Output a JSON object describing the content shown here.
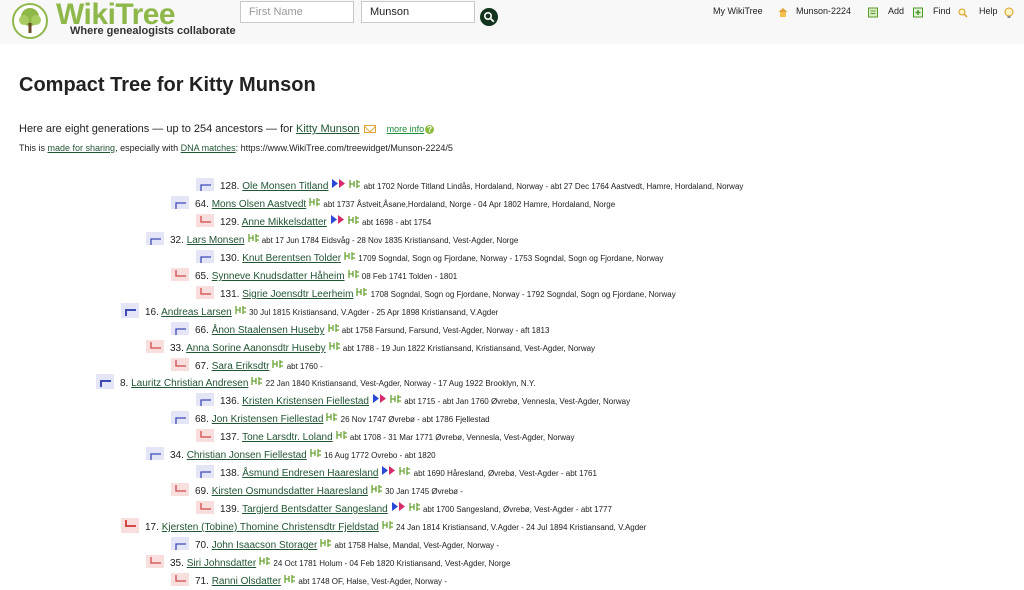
{
  "header": {
    "logo_text": "WikiTree",
    "tagline": "Where genealogists collaborate",
    "first_name_placeholder": "First Name",
    "last_name_value": "Munson",
    "nav": {
      "my_wikitree": "My WikiTree",
      "profile_id": "Munson-2224",
      "add": "Add",
      "find": "Find",
      "help": "Help"
    }
  },
  "page": {
    "title": "Compact Tree for Kitty Munson",
    "intro_prefix": "Here are eight generations — up to 254 ancestors — for",
    "intro_person": "Kitty Munson",
    "more_info": "more info",
    "sub_this": "This is",
    "sub_made_for_sharing": "made for sharing",
    "sub_middle": ", especially with",
    "sub_dna": "DNA matches",
    "sub_url": ": https://www.WikiTree.com/treewidget/Munson-2224/5"
  },
  "colors": {
    "brand_green": "#8fb84a",
    "link_green": "#225533",
    "father_box": "#e4e6f8",
    "mother_box": "#f9dede",
    "father_line": "#3c4bb8",
    "mother_line": "#d24a4a"
  },
  "tree": [
    {
      "num": "128.",
      "name": "Ole Monsen Titland",
      "dna": true,
      "details": "abt 1702 Norde Titland Lindås, Hordaland, Norway - abt 27 Dec 1764 Aastvedt, Hamre, Hordaland, Norway"
    },
    {
      "num": "64.",
      "name": "Mons Olsen Aastvedt",
      "dna": false,
      "details": "abt 1737 Åstveit,Åsane,Hordaland, Norge - 04 Apr 1802 Hamre, Hordaland, Norge"
    },
    {
      "num": "129.",
      "name": "Anne Mikkelsdatter",
      "dna": true,
      "details": "abt 1698 - abt 1754"
    },
    {
      "num": "32.",
      "name": "Lars Monsen",
      "dna": false,
      "details": "abt 17 Jun 1784 Eidsvåg - 28 Nov 1835 Kristiansand, Vest-Agder, Norge"
    },
    {
      "num": "130.",
      "name": "Knut Berentsen Tolder",
      "dna": false,
      "details": "1709 Sogndal, Sogn og Fjordane, Norway - 1753 Sogndal, Sogn og Fjordane, Norway"
    },
    {
      "num": "65.",
      "name": "Synneve Knudsdatter Håheim",
      "dna": false,
      "details": "08 Feb 1741 Tolden - 1801"
    },
    {
      "num": "131.",
      "name": "Sigrie Joensdtr Leerheim",
      "dna": false,
      "details": "1708 Sogndal, Sogn og Fjordane, Norway - 1792 Sogndal, Sogn og Fjordane, Norway"
    },
    {
      "num": "16.",
      "name": "Andreas Larsen",
      "dna": false,
      "details": "30 Jul 1815 Kristiansand, V.Agder - 25 Apr 1898 Kristiansand, V.Agder"
    },
    {
      "num": "66.",
      "name": "Ånon Staalensen Huseby",
      "dna": false,
      "details": "abt 1758 Farsund, Farsund, Vest-Agder, Norway - aft 1813"
    },
    {
      "num": "33.",
      "name": "Anna Sorine Aanonsdtr Huseby",
      "dna": false,
      "details": "abt 1788 - 19 Jun 1822 Kristiansand, Kristiansand, Vest-Agder, Norway"
    },
    {
      "num": "67.",
      "name": "Sara Eriksdtr",
      "dna": false,
      "details": "abt 1760 -"
    },
    {
      "num": "8.",
      "name": "Lauritz Christian Andresen",
      "dna": false,
      "details": "22 Jan 1840 Kristiansand, Vest-Agder, Norway - 17 Aug 1922 Brooklyn, N.Y."
    },
    {
      "num": "136.",
      "name": "Kristen Kristensen Fiellestad",
      "dna": true,
      "details": "abt 1715 - abt Jan 1760 Øvrebø, Vennesla, Vest-Agder, Norway"
    },
    {
      "num": "68.",
      "name": "Jon Kristensen Fiellestad",
      "dna": false,
      "details": "26 Nov 1747 Øvrebø - abt 1786 Fjellestad"
    },
    {
      "num": "137.",
      "name": "Tone Larsdtr. Loland",
      "dna": false,
      "details": "abt 1708 - 31 Mar 1771 Øvrebø, Vennesla, Vest-Agder, Norway"
    },
    {
      "num": "34.",
      "name": "Christian Jonsen Fiellestad",
      "dna": false,
      "details": "16 Aug 1772 Ovrebo - abt 1820"
    },
    {
      "num": "138.",
      "name": "Åsmund Endresen Haaresland",
      "dna": true,
      "details": "abt 1690 Håresland, Øvrebø, Vest-Agder - abt 1761"
    },
    {
      "num": "69.",
      "name": "Kirsten Osmundsdatter Haaresland",
      "dna": false,
      "details": "30 Jan 1745 Øvrebø -"
    },
    {
      "num": "139.",
      "name": "Targjerd Bentsdatter Sangesland",
      "dna": true,
      "details": "abt 1700 Sangesland, Øvrebø, Vest-Agder - abt 1777"
    },
    {
      "num": "17.",
      "name": "Kjersten (Tobine) Thomine Christensdtr Fjeldstad",
      "dna": false,
      "details": "24 Jan 1814 Kristiansand, V.Agder - 24 Jul 1894 Kristiansand, V.Agder"
    },
    {
      "num": "70.",
      "name": "John Isaacson Storager",
      "dna": false,
      "details": "abt 1758 Halse, Mandal, Vest-Agder, Norway -"
    },
    {
      "num": "35.",
      "name": "Siri Johnsdatter",
      "dna": false,
      "details": "24 Oct 1781 Holum - 04 Feb 1820 Kristiansand, Vest-Agder, Norge"
    },
    {
      "num": "71.",
      "name": "Ranni Olsdatter",
      "dna": false,
      "details": "abt 1748 OF, Halse, Vest-Agder, Norway -"
    }
  ]
}
